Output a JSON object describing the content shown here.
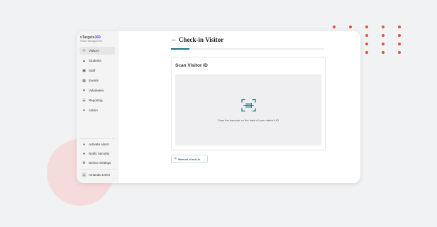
{
  "brand": {
    "name_part1": "vTargets",
    "name_part2": "360",
    "subtitle": "Visitor Management"
  },
  "sidebar": {
    "items": [
      {
        "label": "Visitors",
        "icon": "people-icon"
      },
      {
        "label": "Students",
        "icon": "graduation-cap-icon"
      },
      {
        "label": "Staff",
        "icon": "briefcase-icon"
      },
      {
        "label": "Events",
        "icon": "calendar-icon"
      },
      {
        "label": "Volunteers",
        "icon": "hand-heart-icon"
      },
      {
        "label": "Reporting",
        "icon": "chart-icon"
      },
      {
        "label": "Admin",
        "icon": "wrench-icon"
      }
    ],
    "bottom_items": [
      {
        "label": "Activate Alarm",
        "icon": "bell-icon"
      },
      {
        "label": "Notify Security",
        "icon": "shield-icon"
      },
      {
        "label": "Device Settings",
        "icon": "gear-icon"
      }
    ],
    "user": {
      "initials": "AJ",
      "name": "Amanda Jones"
    }
  },
  "page": {
    "title": "Check-in Visitor"
  },
  "scan_card": {
    "title": "Scan Visitor ID",
    "instruction": "Scan the barcode on the back of your visitor's ID"
  },
  "manual_checkin": {
    "label": "Manual check-in"
  },
  "colors": {
    "accent": "#1b6f80",
    "brand": "#6d3fc9",
    "dots": "#e8502e"
  }
}
